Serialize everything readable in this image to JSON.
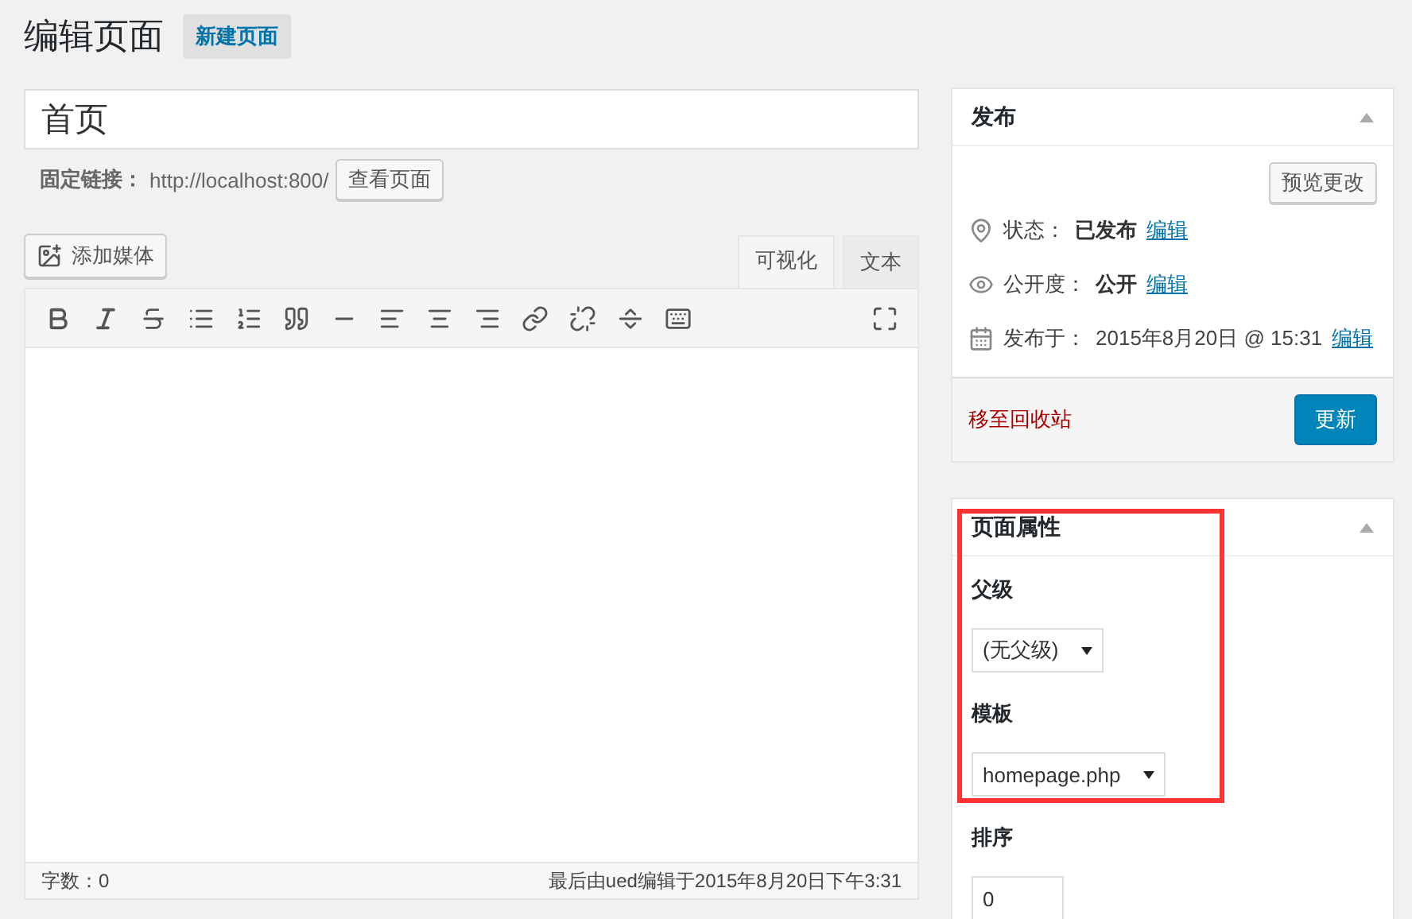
{
  "heading": {
    "title": "编辑页面",
    "add_new": "新建页面"
  },
  "post_title": {
    "value": "首页"
  },
  "permalink": {
    "label": "固定链接：",
    "url": "http://localhost:800/",
    "button": "查看页面"
  },
  "add_media": "添加媒体",
  "editor_tabs": [
    {
      "label": "可视化",
      "selected": true
    },
    {
      "label": "文本",
      "selected": false
    }
  ],
  "editor_footer": {
    "word_count": "字数：0",
    "last_edited": "最后由ued编辑于2015年8月20日下午3:31"
  },
  "publish": {
    "title": "发布",
    "preview_button": "预览更改",
    "rows": [
      {
        "kind": "status",
        "label": "状态：",
        "value": "已发布",
        "link": "编辑"
      },
      {
        "kind": "visibility",
        "label": "公开度：",
        "value": "公开",
        "link": "编辑"
      },
      {
        "kind": "date",
        "label": "发布于：",
        "value": "2015年8月20日 @ 15:31",
        "link": "编辑"
      }
    ],
    "trash_link": "移至回收站",
    "update_button": "更新"
  },
  "page_attributes": {
    "title": "页面属性",
    "highlighted": true,
    "parent_label": "父级",
    "parent_value": "(无父级)",
    "template_label": "模板",
    "template_value": "homepage.php",
    "order_label": "排序",
    "order_value": "0"
  }
}
